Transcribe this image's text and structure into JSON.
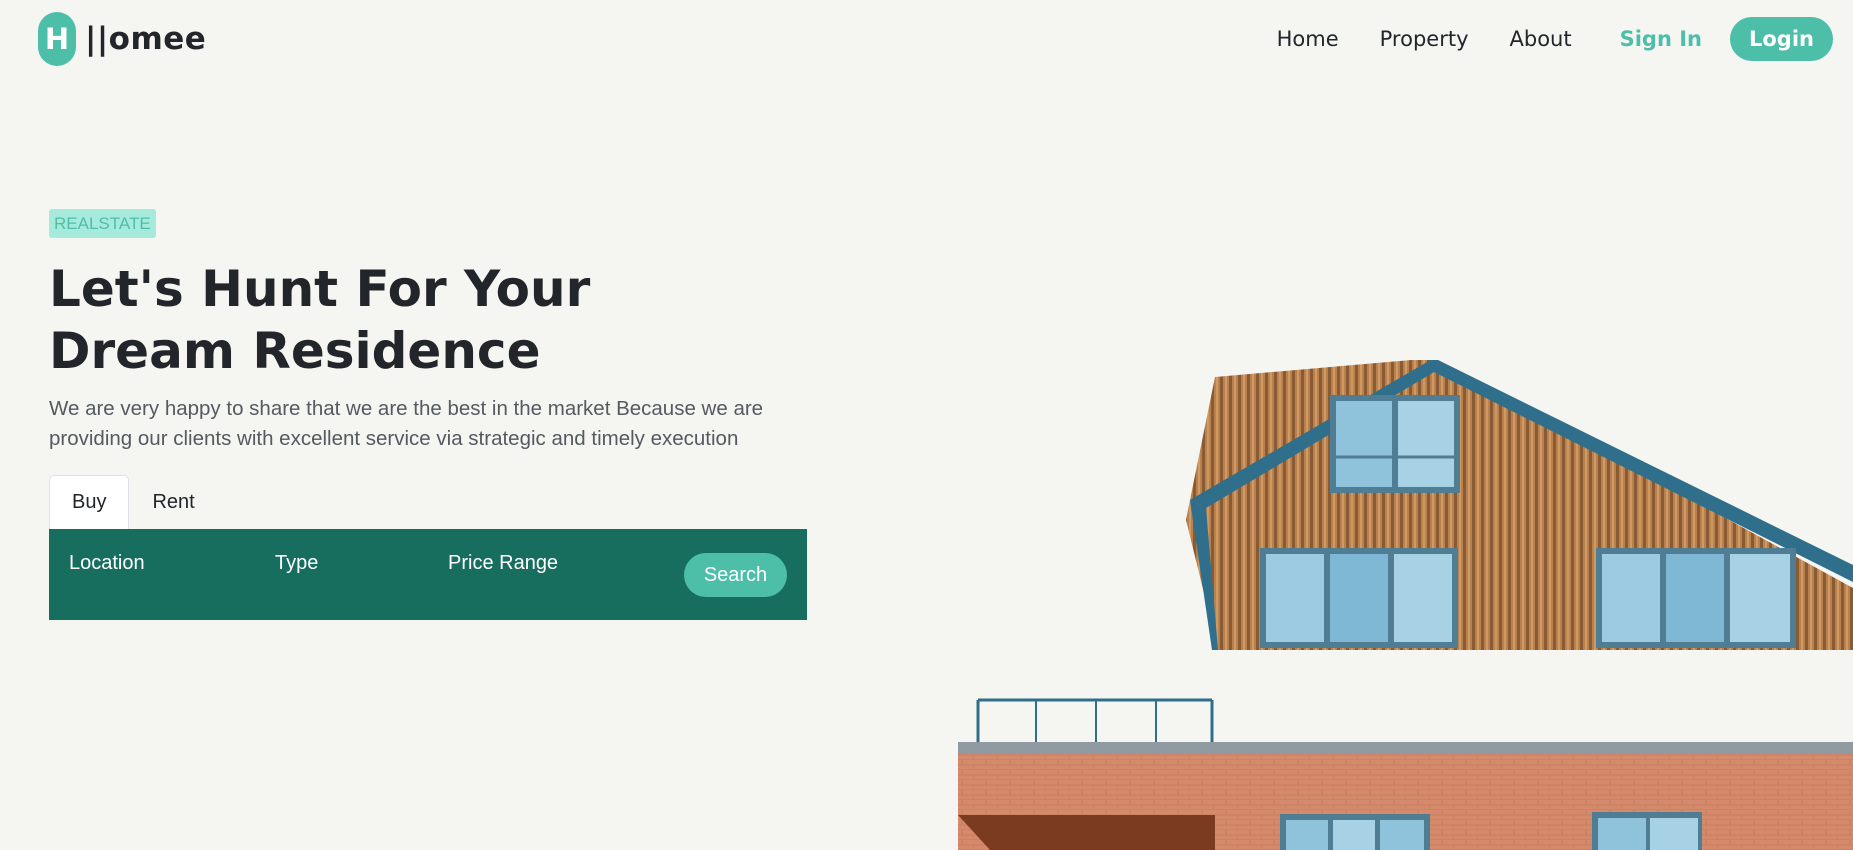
{
  "brand": {
    "mark": "H",
    "name": "||omee"
  },
  "nav": {
    "links": [
      "Home",
      "Property",
      "About"
    ],
    "signin": "Sign In",
    "login": "Login"
  },
  "hero": {
    "badge": "REALSTATE",
    "title_line1": "Let's Hunt For Your",
    "title_line2": "Dream Residence",
    "description": "We are very happy to share that we are the best in the market Because we are providing our clients with excellent service via strategic and timely execution"
  },
  "tabs": {
    "active": "Buy",
    "items": [
      "Buy",
      "Rent"
    ]
  },
  "search": {
    "fields": [
      "Location",
      "Type",
      "Price Range"
    ],
    "button": "Search"
  },
  "colors": {
    "accent": "#4dbfa9",
    "accent_light": "#a6eadb",
    "panel": "#176e5e",
    "background": "#f5f5f2",
    "text": "#222529"
  },
  "image": {
    "icon": "house-photo"
  }
}
